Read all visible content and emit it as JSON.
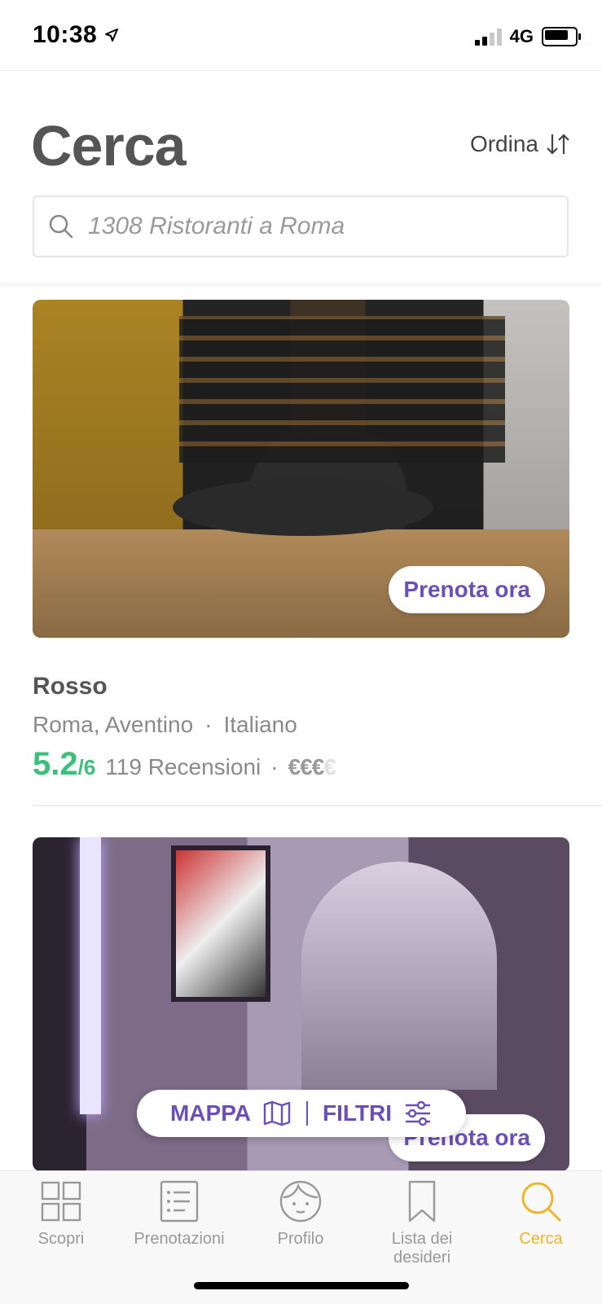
{
  "status": {
    "time": "10:38",
    "network": "4G"
  },
  "header": {
    "title": "Cerca",
    "sort_label": "Ordina",
    "search_placeholder": "1308 Ristoranti a Roma"
  },
  "results": [
    {
      "book_label": "Prenota ora",
      "name": "Rosso",
      "location": "Roma, Aventino",
      "cuisine": "Italiano",
      "score": "5.2",
      "score_max": "/6",
      "reviews": "119 Recensioni",
      "price_filled": "€€€",
      "price_empty": "€"
    },
    {
      "book_label": "Prenota ora"
    }
  ],
  "floating_bar": {
    "map_label": "MAPPA",
    "filters_label": "FILTRI"
  },
  "tabbar": {
    "items": [
      {
        "label": "Scopri",
        "icon": "grid-icon"
      },
      {
        "label": "Prenotazioni",
        "icon": "list-icon"
      },
      {
        "label": "Profilo",
        "icon": "face-icon"
      },
      {
        "label": "Lista dei desideri",
        "icon": "bookmark-icon"
      },
      {
        "label": "Cerca",
        "icon": "search-icon"
      }
    ],
    "active_color": "#f0b429"
  },
  "colors": {
    "accent": "#6b4fb8",
    "score": "#3bbf7a"
  }
}
